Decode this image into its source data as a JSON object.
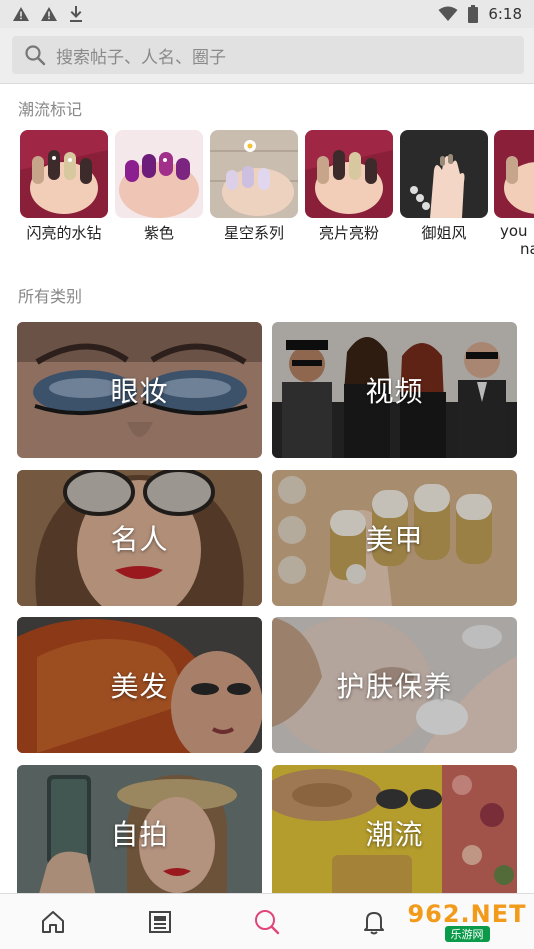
{
  "status_bar": {
    "time": "6:18",
    "icons": [
      "warning-icon",
      "warning-icon",
      "download-icon",
      "wifi-icon",
      "battery-icon"
    ]
  },
  "search": {
    "placeholder": "搜索帖子、人名、圈子"
  },
  "trending": {
    "title": "潮流标记",
    "items": [
      {
        "label": "闪亮的水钻"
      },
      {
        "label": "紫色"
      },
      {
        "label": "星空系列"
      },
      {
        "label": "亮片亮粉"
      },
      {
        "label": "御姐风"
      },
      {
        "label": "you",
        "label2": "na"
      }
    ]
  },
  "categories": {
    "title": "所有类别",
    "items": [
      {
        "name": "眼妆"
      },
      {
        "name": "视频"
      },
      {
        "name": "名人"
      },
      {
        "name": "美甲"
      },
      {
        "name": "美发"
      },
      {
        "name": "护肤保养"
      },
      {
        "name": "自拍"
      },
      {
        "name": "潮流"
      }
    ]
  },
  "bottom_nav": {
    "items": [
      "home-icon",
      "feed-icon",
      "search-icon",
      "notification-icon"
    ],
    "active": "search-icon",
    "active_color": "#e0457b"
  },
  "watermark": {
    "top": "962.NET",
    "bottom": "乐游网"
  }
}
